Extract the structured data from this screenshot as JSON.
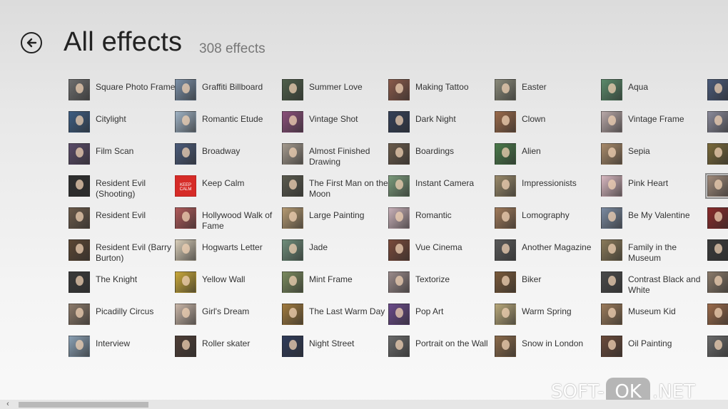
{
  "header": {
    "title": "All effects",
    "count": "308 effects"
  },
  "columns": [
    [
      {
        "label": "Square Photo Frame",
        "color": "#6e6e6e"
      },
      {
        "label": "Citylight",
        "color": "#3d5d82"
      },
      {
        "label": "Film Scan",
        "color": "#5a4a68"
      },
      {
        "label": "Resident Evil (Shooting)",
        "color": "#2e2e2e"
      },
      {
        "label": "Resident Evil",
        "color": "#6b5a4a"
      },
      {
        "label": "Resident Evil (Barry Burton)",
        "color": "#5b4633"
      },
      {
        "label": "The Knight",
        "color": "#3a3a3a"
      },
      {
        "label": "Picadilly Circus",
        "color": "#8c7a6a"
      },
      {
        "label": "Interview",
        "color": "#8aa0b4"
      }
    ],
    [
      {
        "label": "Graffiti Billboard",
        "color": "#7b90a8"
      },
      {
        "label": "Romantic Etude",
        "color": "#9fb2c4"
      },
      {
        "label": "Broadway",
        "color": "#4b5b7a"
      },
      {
        "label": "Keep Calm",
        "color": "#d62b27",
        "thumb_text": "KEEP CALM"
      },
      {
        "label": "Hollywood Walk of Fame",
        "color": "#b05a5a"
      },
      {
        "label": "Hogwarts Letter",
        "color": "#d8cdb8"
      },
      {
        "label": "Yellow Wall",
        "color": "#c9a83a"
      },
      {
        "label": "Girl's Dream",
        "color": "#c9b6a8"
      },
      {
        "label": "Roller skater",
        "color": "#4e3e36"
      }
    ],
    [
      {
        "label": "Summer Love",
        "color": "#4f5f4a"
      },
      {
        "label": "Vintage Shot",
        "color": "#8a4f7a"
      },
      {
        "label": "Almost Finished Drawing",
        "color": "#a49a8e"
      },
      {
        "label": "The First Man on the Moon",
        "color": "#5a5a4e"
      },
      {
        "label": "Large Painting",
        "color": "#b59a72"
      },
      {
        "label": "Jade",
        "color": "#6f8d7a"
      },
      {
        "label": "Mint Frame",
        "color": "#7a8a5e"
      },
      {
        "label": "The Last Warm Day",
        "color": "#a07a3e"
      },
      {
        "label": "Night Street",
        "color": "#2f3b5a"
      }
    ],
    [
      {
        "label": "Making Tattoo",
        "color": "#8a5a4a"
      },
      {
        "label": "Dark Night",
        "color": "#344058"
      },
      {
        "label": "Boardings",
        "color": "#6a5a4a"
      },
      {
        "label": "Instant Camera",
        "color": "#7a9a7a"
      },
      {
        "label": "Romantic",
        "color": "#c8b0b8"
      },
      {
        "label": "Vue Cinema",
        "color": "#7a4a3a"
      },
      {
        "label": "Textorize",
        "color": "#9a8a8a"
      },
      {
        "label": "Pop Art",
        "color": "#6a4a8a"
      },
      {
        "label": "Portrait on the Wall",
        "color": "#6a6a6a"
      }
    ],
    [
      {
        "label": "Easter",
        "color": "#8a8a7a"
      },
      {
        "label": "Clown",
        "color": "#9a6a4a"
      },
      {
        "label": "Alien",
        "color": "#4a7a4a"
      },
      {
        "label": "Impressionists",
        "color": "#9a8a6a"
      },
      {
        "label": "Lomography",
        "color": "#a07a5a"
      },
      {
        "label": "Another Magazine",
        "color": "#5a5a5a"
      },
      {
        "label": "Biker",
        "color": "#7a5a3a"
      },
      {
        "label": "Warm Spring",
        "color": "#b8a87a"
      },
      {
        "label": "Snow in London",
        "color": "#8a6a4a"
      }
    ],
    [
      {
        "label": "Aqua",
        "color": "#5a8a6a"
      },
      {
        "label": "Vintage Frame",
        "color": "#b8a8a8"
      },
      {
        "label": "Sepia",
        "color": "#a88a6a"
      },
      {
        "label": "Pink Heart",
        "color": "#d8b8c0"
      },
      {
        "label": "Be My Valentine",
        "color": "#7a8aa0"
      },
      {
        "label": "Family in the Museum",
        "color": "#8a7a5a"
      },
      {
        "label": "Contrast Black and White",
        "color": "#4a4a4a"
      },
      {
        "label": "Museum Kid",
        "color": "#9a7a5a"
      },
      {
        "label": "Oil Painting",
        "color": "#6a4a3a"
      }
    ],
    [
      {
        "label": "",
        "color": "#4a5a7a"
      },
      {
        "label": "",
        "color": "#8a8a9a"
      },
      {
        "label": "",
        "color": "#7a6a3a"
      },
      {
        "label": "",
        "color": "#a08a7a",
        "selected": true
      },
      {
        "label": "",
        "color": "#8a2a2a"
      },
      {
        "label": "",
        "color": "#3a3a3a"
      },
      {
        "label": "",
        "color": "#8a7a6a"
      },
      {
        "label": "",
        "color": "#9a6a4a"
      },
      {
        "label": "",
        "color": "#6a6a6a"
      }
    ]
  ],
  "watermark": {
    "left": "SOFT-",
    "pill": "OK",
    "right": ".NET"
  },
  "scrollbar": {
    "left_arrow": "‹"
  }
}
